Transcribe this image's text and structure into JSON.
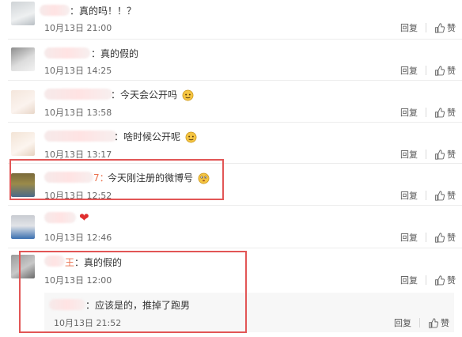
{
  "comments": [
    {
      "text": "：真的吗！！？",
      "time": "10月13日 21:00"
    },
    {
      "text": "：真的假的",
      "time": "10月13日 14:25"
    },
    {
      "text": "：今天会公开吗",
      "time": "10月13日 13:58",
      "emoji": "face-emoji"
    },
    {
      "text": "：啥时候公开呢",
      "time": "10月13日 13:17",
      "emoji": "face-emoji"
    },
    {
      "text": "今天刚注册的微博号",
      "name_tail": "7：",
      "time": "10月13日 12:52",
      "emoji": "thinking-face-emoji"
    },
    {
      "text": "",
      "time": "10月13日 12:46",
      "emoji": "heart-emoji"
    },
    {
      "text": "：真的假的",
      "name_tail": "王",
      "time": "10月13日 12:00"
    }
  ],
  "sub_reply": {
    "text": "：应该是的，推掉了跑男",
    "time": "10月13日 21:52"
  },
  "actions": {
    "reply_label": "回复",
    "like_label": "赞"
  },
  "colors": {
    "highlight": "#e25656",
    "heart": "#e02e2e"
  }
}
